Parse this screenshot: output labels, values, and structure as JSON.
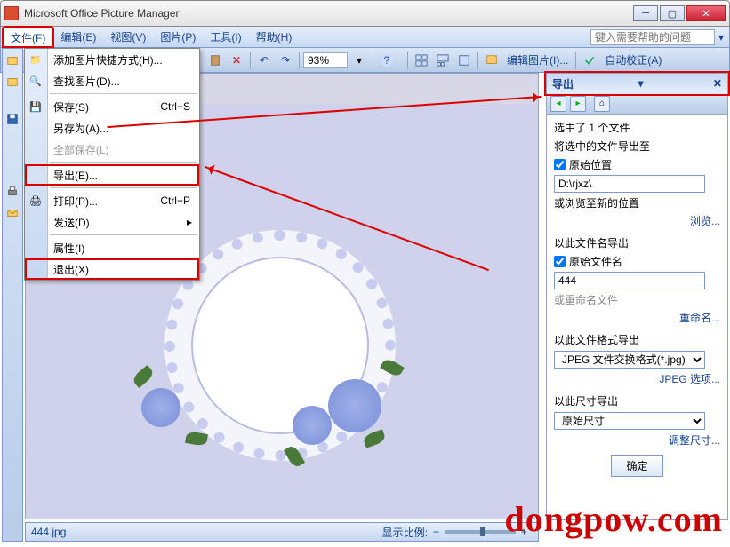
{
  "window": {
    "title": "Microsoft Office Picture Manager"
  },
  "menubar": {
    "file": "文件(F)",
    "edit": "编辑(E)",
    "view": "视图(V)",
    "picture": "图片(P)",
    "tools": "工具(I)",
    "help": "帮助(H)",
    "help_placeholder": "键入需要帮助的问题"
  },
  "toolbar": {
    "zoom_value": "93%",
    "edit_picture": "编辑图片(I)...",
    "auto_correct": "自动校正(A)"
  },
  "file_menu": {
    "add_shortcut": "添加图片快捷方式(H)...",
    "find_pictures": "查找图片(D)...",
    "save": "保存(S)",
    "save_shortcut": "Ctrl+S",
    "save_as": "另存为(A)...",
    "save_all": "全部保存(L)",
    "export": "导出(E)...",
    "print": "打印(P)...",
    "print_shortcut": "Ctrl+P",
    "send": "发送(D)",
    "properties": "属性(I)",
    "exit": "退出(X)"
  },
  "sidepanel": {
    "title": "导出",
    "selected": "选中了 1 个文件",
    "export_to_label": "将选中的文件导出至",
    "orig_location_chk": "原始位置",
    "path_value": "D:\\rjxz\\",
    "browse_hint": "或浏览至新的位置",
    "browse_link": "浏览...",
    "name_label": "以此文件名导出",
    "orig_name_chk": "原始文件名",
    "name_value": "444",
    "rename_hint": "或重命名文件",
    "rename_link": "重命名...",
    "format_label": "以此文件格式导出",
    "format_value": "JPEG 文件交换格式(*.jpg)",
    "jpeg_options_link": "JPEG 选项...",
    "size_label": "以此尺寸导出",
    "size_value": "原始尺寸",
    "resize_link": "调整尺寸...",
    "ok_button": "确定"
  },
  "statusbar": {
    "filename": "444.jpg",
    "zoom_label": "显示比例:"
  },
  "watermark": "dongpow.com"
}
